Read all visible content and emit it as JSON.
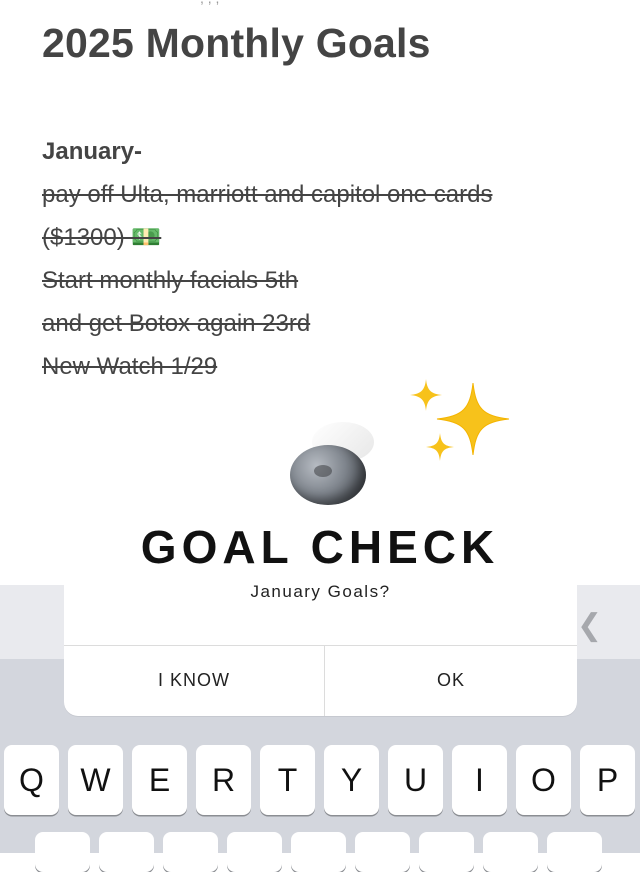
{
  "note": {
    "title": "2025 Monthly Goals",
    "month_heading": "January-",
    "goal_lines": [
      "pay off Ulta, marriott and capitol one cards",
      "($1300) 💵",
      "Start monthly facials 5th",
      "and get Botox again 23rd",
      "New Watch 1/29"
    ]
  },
  "overlay": {
    "headline": "GOAL CHECK",
    "sparkles_emoji": "✨",
    "moon_emoji_name": "full-moon-icon"
  },
  "alert": {
    "message": "January Goals?",
    "left_button": "I KNOW",
    "right_button": "OK"
  },
  "keyboard": {
    "row1": [
      "Q",
      "W",
      "E",
      "R",
      "T",
      "Y",
      "U",
      "I",
      "O",
      "P"
    ],
    "accessory_icon": "chevron-left-icon"
  },
  "colors": {
    "text": "#444444",
    "keyboard_bg": "#d3d6dd",
    "sparkle": "#f7c21b"
  }
}
